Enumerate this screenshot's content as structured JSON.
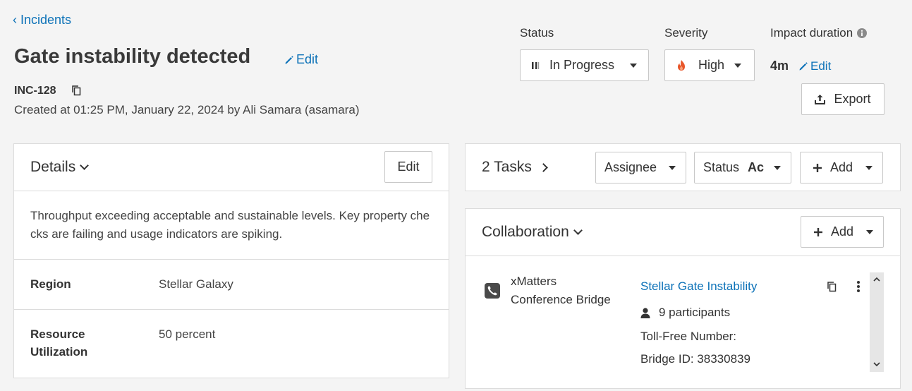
{
  "breadcrumb": {
    "back_label": "Incidents"
  },
  "incident": {
    "title": "Gate instability detected",
    "edit_label": "Edit",
    "id": "INC-128",
    "created": "Created at 01:25 PM, January 22, 2024 by Ali Samara (asamara)"
  },
  "status": {
    "label": "Status",
    "value": "In Progress"
  },
  "severity": {
    "label": "Severity",
    "value": "High",
    "color": "#e8562a"
  },
  "impact": {
    "label": "Impact duration",
    "value": "4m",
    "edit_label": "Edit"
  },
  "export_label": "Export",
  "details": {
    "title": "Details",
    "edit_label": "Edit",
    "description": "Throughput exceeding acceptable and sustainable levels. Key property checks are failing and usage indicators are spiking.",
    "fields": [
      {
        "label": "Region",
        "value": "Stellar Galaxy"
      },
      {
        "label": "Resource Utilization",
        "value": "50 percent"
      }
    ]
  },
  "tasks": {
    "title": "2 Tasks",
    "assignee_label": "Assignee",
    "status_label": "Status",
    "status_value": "Ac",
    "add_label": "Add"
  },
  "collaboration": {
    "title": "Collaboration",
    "add_label": "Add",
    "bridge": {
      "type_line1": "xMatters",
      "type_line2": "Conference Bridge",
      "name": "Stellar Gate Instability",
      "participants": "9 participants",
      "toll_free": "Toll-Free Number:",
      "bridge_id": "Bridge ID: 38330839"
    }
  },
  "colors": {
    "link": "#0d72b8",
    "background": "#f4f4f4"
  },
  "icons": [
    "chevron-left-icon",
    "pencil-icon",
    "copy-icon",
    "pause-icon",
    "flame-icon",
    "info-icon",
    "upload-icon",
    "plus-icon",
    "phone-icon",
    "user-icon",
    "kebab-icon"
  ]
}
